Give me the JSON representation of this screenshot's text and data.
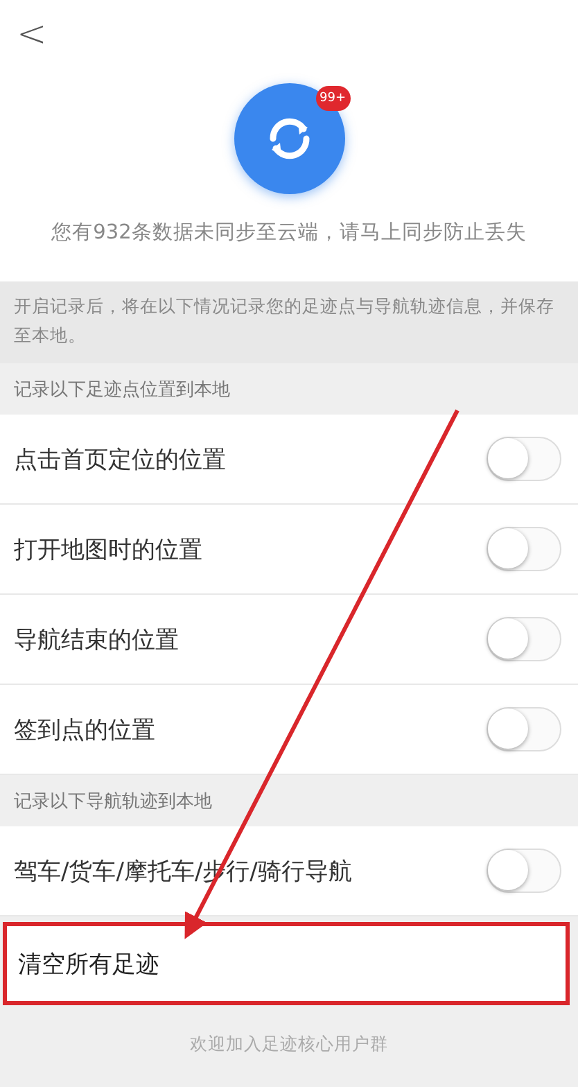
{
  "back": "<",
  "sync": {
    "badge": "99+",
    "message": "您有932条数据未同步至云端，请马上同步防止丢失"
  },
  "notice": "开启记录后，将在以下情况记录您的足迹点与导航轨迹信息，并保存至本地。",
  "sections": [
    {
      "title": "记录以下足迹点位置到本地",
      "items": [
        {
          "label": "点击首页定位的位置",
          "on": false
        },
        {
          "label": "打开地图时的位置",
          "on": false
        },
        {
          "label": "导航结束的位置",
          "on": false
        },
        {
          "label": "签到点的位置",
          "on": false
        }
      ]
    },
    {
      "title": "记录以下导航轨迹到本地",
      "items": [
        {
          "label": "驾车/货车/摩托车/步行/骑行导航",
          "on": false
        }
      ]
    }
  ],
  "clear": {
    "label": "清空所有足迹",
    "highlighted": true
  },
  "footer": "欢迎加入足迹核心用户群"
}
